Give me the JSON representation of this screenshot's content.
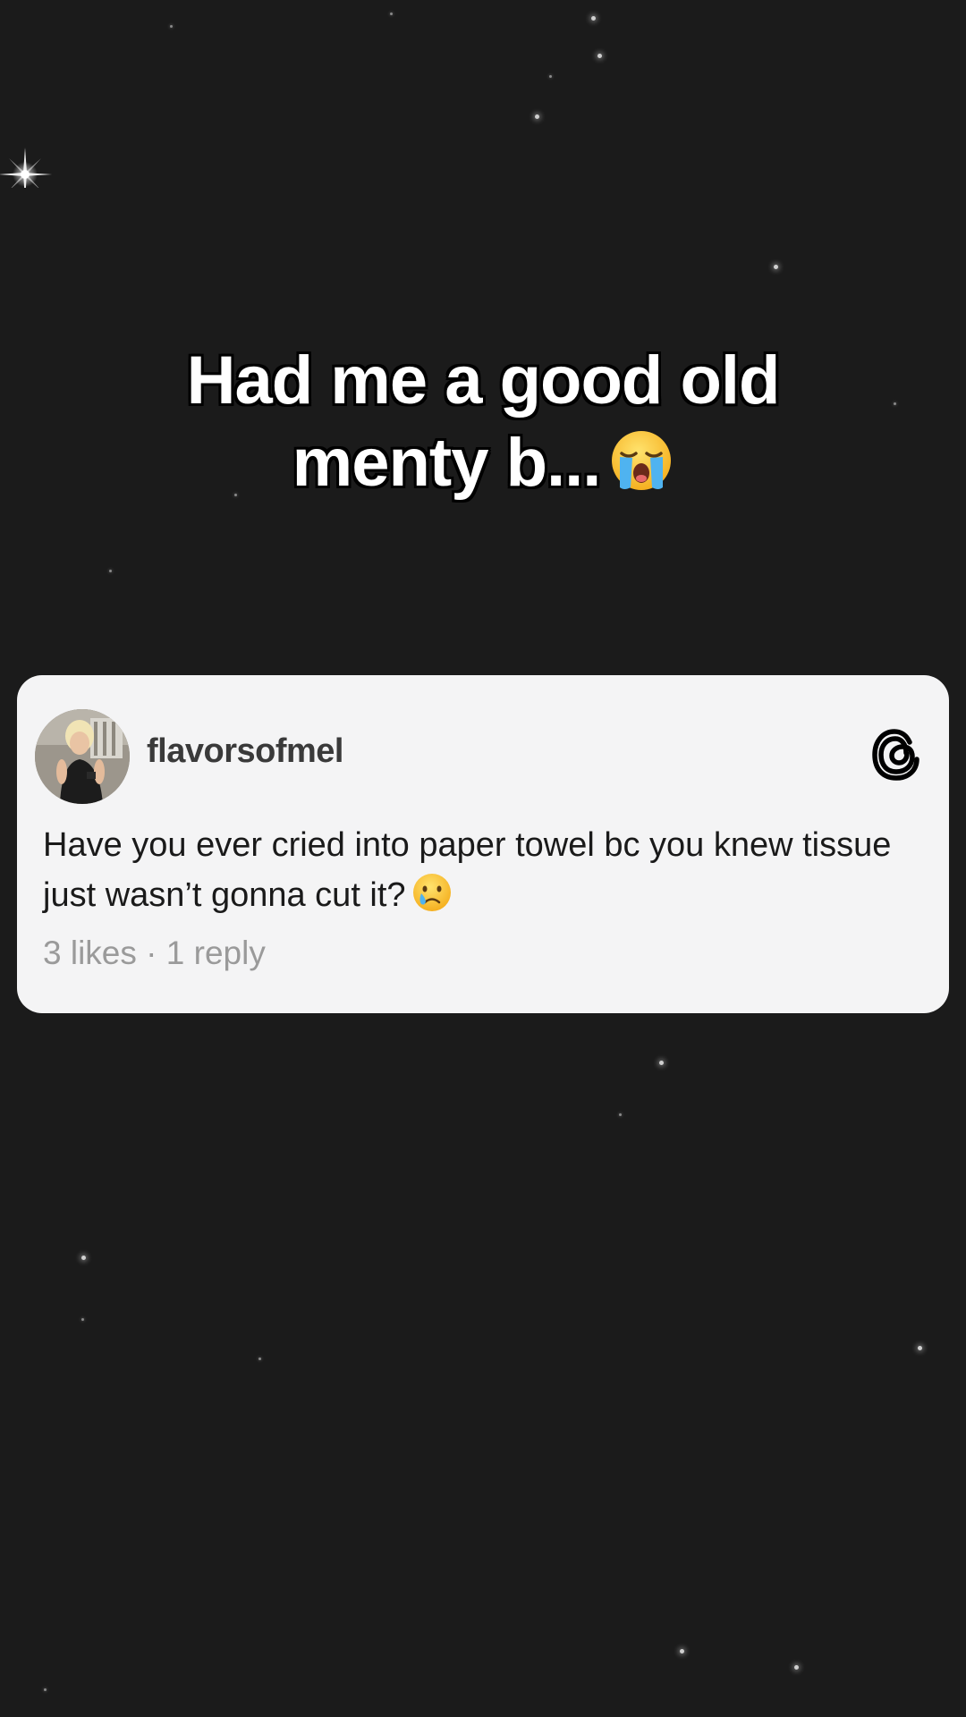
{
  "caption": {
    "line1": "Had me a good old",
    "line2": "menty b...",
    "emoji": "loudly-crying-face"
  },
  "post": {
    "username": "flavorsofmel",
    "avatar": "profile-photo",
    "platform_icon": "threads-icon",
    "text": "Have you ever cried into paper towel bc you knew tissue just wasn’t gonna cut it?",
    "text_emoji": "crying-face",
    "likes": "3 likes",
    "separator": " · ",
    "replies": "1 reply"
  },
  "colors": {
    "background": "#1b1b1b",
    "card": "#f4f4f5",
    "username": "#3a3a3a",
    "meta": "#9a9a9a"
  }
}
